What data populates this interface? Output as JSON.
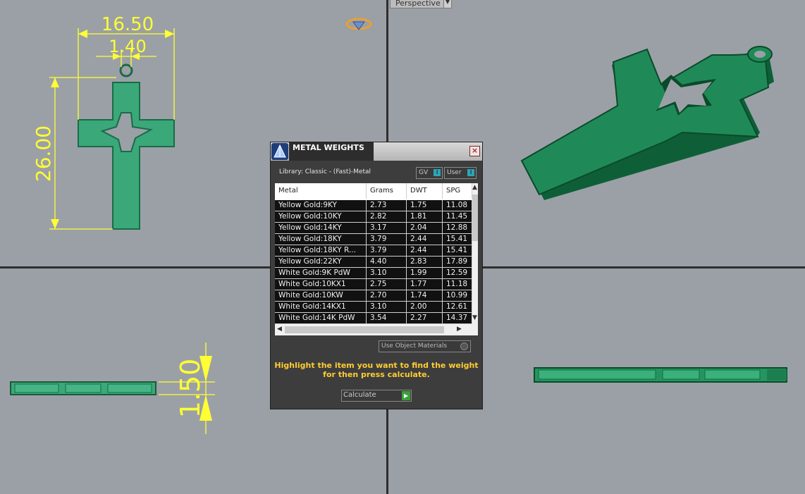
{
  "viewport": {
    "perspective_label": "Perspective"
  },
  "dimensions": {
    "width": "16.50",
    "bail": "1.40",
    "height": "26.00",
    "thickness": "1.50"
  },
  "dialog": {
    "title": "METAL WEIGHTS",
    "library": "Library: Classic - (Fast)-Metal",
    "toggle_gv": "GV",
    "toggle_user": "User",
    "columns": [
      "Metal",
      "Grams",
      "DWT",
      "SPG"
    ],
    "rows": [
      [
        "Yellow Gold:9KY",
        "2.73",
        "1.75",
        "11.08"
      ],
      [
        "Yellow Gold:10KY",
        "2.82",
        "1.81",
        "11.45"
      ],
      [
        "Yellow Gold:14KY",
        "3.17",
        "2.04",
        "12.88"
      ],
      [
        "Yellow Gold:18KY",
        "3.79",
        "2.44",
        "15.41"
      ],
      [
        "Yellow Gold:18KY R...",
        "3.79",
        "2.44",
        "15.41"
      ],
      [
        "Yellow Gold:22KY",
        "4.40",
        "2.83",
        "17.89"
      ],
      [
        "White Gold:9K PdW",
        "3.10",
        "1.99",
        "12.59"
      ],
      [
        "White Gold:10KX1",
        "2.75",
        "1.77",
        "11.18"
      ],
      [
        "White Gold:10KW",
        "2.70",
        "1.74",
        "10.99"
      ],
      [
        "White Gold:14KX1",
        "3.10",
        "2.00",
        "12.61"
      ],
      [
        "White Gold:14K PdW",
        "3.54",
        "2.27",
        "14.37"
      ]
    ],
    "use_object_materials": "Use Object Materials",
    "hint_line1": "Highlight the item you want to find the weight",
    "hint_line2": "for then press calculate.",
    "calculate": "Calculate"
  }
}
